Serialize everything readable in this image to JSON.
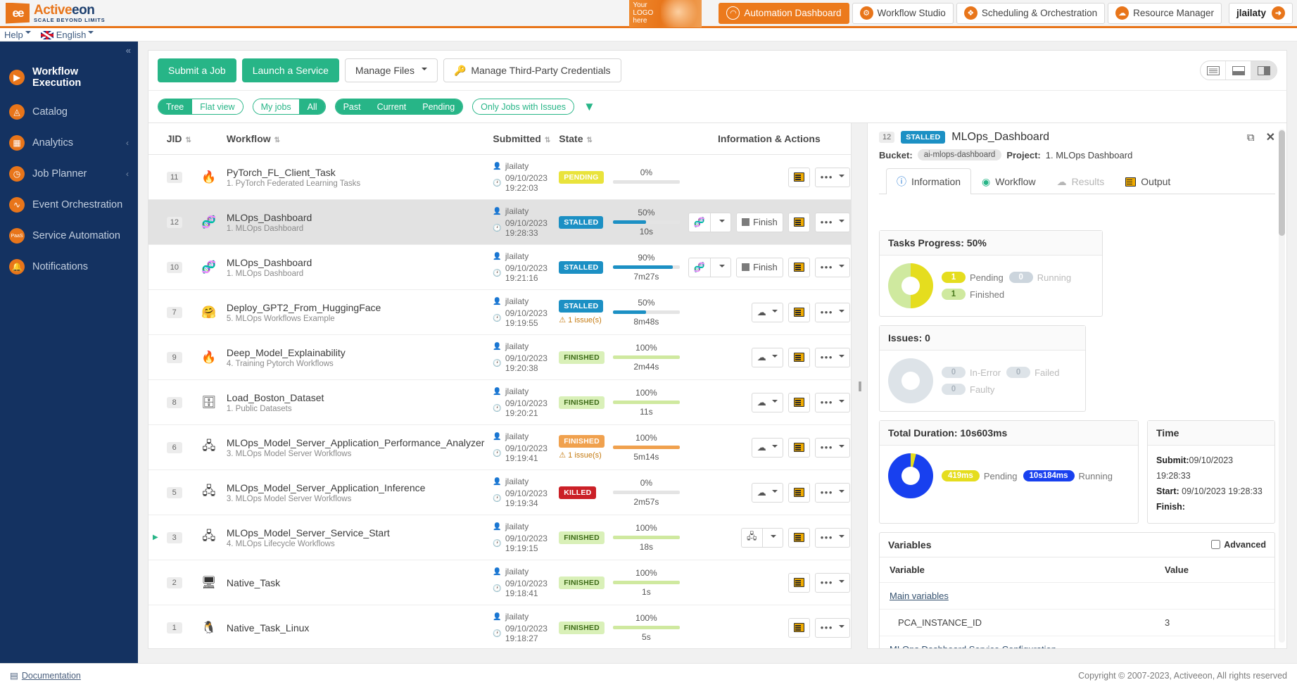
{
  "brand": {
    "name_part1": "Active",
    "name_part2": "eon",
    "tagline": "SCALE BEYOND LIMITS",
    "mark": "ee"
  },
  "help_row": {
    "help_label": "Help",
    "language_label": "English"
  },
  "promo": {
    "line1": "Your",
    "line2": "LOGO",
    "line3": "here"
  },
  "nav": {
    "items": [
      {
        "label": "Automation Dashboard",
        "icon": "gauge-icon",
        "active": true
      },
      {
        "label": "Workflow Studio",
        "icon": "workflow-studio-icon",
        "active": false
      },
      {
        "label": "Scheduling & Orchestration",
        "icon": "scheduling-icon",
        "active": false
      },
      {
        "label": "Resource Manager",
        "icon": "resource-manager-icon",
        "active": false
      }
    ],
    "user": "jlailaty"
  },
  "sidebar": {
    "collapse_icon": "«",
    "items": [
      {
        "label": "Workflow Execution",
        "icon": "play-circle-icon",
        "active": true,
        "chevron": ""
      },
      {
        "label": "Catalog",
        "icon": "catalog-icon",
        "active": false,
        "chevron": ""
      },
      {
        "label": "Analytics",
        "icon": "analytics-icon",
        "active": false,
        "chevron": "‹"
      },
      {
        "label": "Job Planner",
        "icon": "clock-icon",
        "active": false,
        "chevron": "‹"
      },
      {
        "label": "Event Orchestration",
        "icon": "pulse-icon",
        "active": false,
        "chevron": ""
      },
      {
        "label": "Service Automation",
        "icon": "paas-icon",
        "active": false,
        "chevron": ""
      },
      {
        "label": "Notifications",
        "icon": "bell-icon",
        "active": false,
        "chevron": ""
      }
    ]
  },
  "toolbar": {
    "submit_job": "Submit a Job",
    "launch_service": "Launch a Service",
    "manage_files": "Manage Files",
    "manage_credentials": "Manage Third-Party Credentials",
    "credentials_icon": "key-icon",
    "view_modes": [
      {
        "name": "list-view",
        "active": false
      },
      {
        "name": "split-horizontal-view",
        "active": false
      },
      {
        "name": "split-vertical-view",
        "active": true
      }
    ]
  },
  "filters": {
    "group1": [
      {
        "label": "Tree",
        "on": true
      },
      {
        "label": "Flat view",
        "on": false
      }
    ],
    "group2": [
      {
        "label": "My jobs",
        "on": false
      },
      {
        "label": "All",
        "on": true
      }
    ],
    "group3": [
      {
        "label": "Past",
        "on": true
      },
      {
        "label": "Current",
        "on": true
      },
      {
        "label": "Pending",
        "on": true
      }
    ],
    "group4": [
      {
        "label": "Only Jobs with Issues",
        "on": false
      }
    ],
    "funnel_icon": "filter-funnel-icon"
  },
  "table": {
    "headers": [
      "JID",
      "Workflow",
      "Submitted",
      "State",
      "Information & Actions"
    ],
    "rows": [
      {
        "jid": "11",
        "icon": "🔥",
        "name": "PyTorch_FL_Client_Task",
        "project": "1. PyTorch Federated Learning Tasks",
        "user": "jlailaty",
        "time": "09/10/2023 19:22:03",
        "state": "PENDING",
        "state_class": "st-PENDING",
        "issues": "",
        "pct": "0%",
        "pct_val": 0,
        "bar_color": "#d9d9d9",
        "duration": "",
        "expand": false,
        "selected": false,
        "actions": {
          "primary": "",
          "finish": false,
          "cloud": false,
          "output": true,
          "more": true
        }
      },
      {
        "jid": "12",
        "icon": "🧬",
        "name": "MLOps_Dashboard",
        "project": "1. MLOps Dashboard",
        "user": "jlailaty",
        "time": "09/10/2023 19:28:33",
        "state": "STALLED",
        "state_class": "st-STALLED",
        "issues": "",
        "pct": "50%",
        "pct_val": 50,
        "bar_color": "#1c90c4",
        "duration": "10s",
        "expand": false,
        "selected": true,
        "actions": {
          "primary": "service-icon",
          "finish": true,
          "finish_label": "Finish",
          "cloud": false,
          "output": true,
          "more": true
        }
      },
      {
        "jid": "10",
        "icon": "🧬",
        "name": "MLOps_Dashboard",
        "project": "1. MLOps Dashboard",
        "user": "jlailaty",
        "time": "09/10/2023 19:21:16",
        "state": "STALLED",
        "state_class": "st-STALLED",
        "issues": "",
        "pct": "90%",
        "pct_val": 90,
        "bar_color": "#1c90c4",
        "duration": "7m27s",
        "expand": false,
        "selected": false,
        "actions": {
          "primary": "service-icon",
          "finish": true,
          "finish_label": "Finish",
          "cloud": false,
          "output": true,
          "more": true
        }
      },
      {
        "jid": "7",
        "icon": "🤗",
        "name": "Deploy_GPT2_From_HuggingFace",
        "project": "5. MLOps Workflows Example",
        "user": "jlailaty",
        "time": "09/10/2023 19:19:55",
        "state": "STALLED",
        "state_class": "st-STALLED",
        "issues": "1 issue(s)",
        "pct": "50%",
        "pct_val": 50,
        "bar_color": "#1c90c4",
        "duration": "8m48s",
        "expand": false,
        "selected": false,
        "actions": {
          "primary": "",
          "finish": false,
          "cloud": true,
          "output": true,
          "more": true
        }
      },
      {
        "jid": "9",
        "icon": "🔥",
        "name": "Deep_Model_Explainability",
        "project": "4. Training Pytorch Workflows",
        "user": "jlailaty",
        "time": "09/10/2023 19:20:38",
        "state": "FINISHED",
        "state_class": "st-FINISHED",
        "issues": "",
        "pct": "100%",
        "pct_val": 100,
        "bar_color": "#cfe99f",
        "duration": "2m44s",
        "expand": false,
        "selected": false,
        "actions": {
          "primary": "",
          "finish": false,
          "cloud": true,
          "output": true,
          "more": true
        }
      },
      {
        "jid": "8",
        "icon": "🗄",
        "name": "Load_Boston_Dataset",
        "project": "1. Public Datasets",
        "user": "jlailaty",
        "time": "09/10/2023 19:20:21",
        "state": "FINISHED",
        "state_class": "st-FINISHED",
        "issues": "",
        "pct": "100%",
        "pct_val": 100,
        "bar_color": "#cfe99f",
        "duration": "11s",
        "expand": false,
        "selected": false,
        "actions": {
          "primary": "",
          "finish": false,
          "cloud": true,
          "output": true,
          "more": true
        }
      },
      {
        "jid": "6",
        "icon": "🖧",
        "name": "MLOps_Model_Server_Application_Performance_Analyzer",
        "project": "3. MLOps Model Server Workflows",
        "user": "jlailaty",
        "time": "09/10/2023 19:19:41",
        "state": "FINISHED",
        "state_class": "st-FINISHED-issue",
        "issues": "1 issue(s)",
        "pct": "100%",
        "pct_val": 100,
        "bar_color": "#f0a14e",
        "duration": "5m14s",
        "expand": false,
        "selected": false,
        "actions": {
          "primary": "",
          "finish": false,
          "cloud": true,
          "output": true,
          "more": true
        }
      },
      {
        "jid": "5",
        "icon": "🖧",
        "name": "MLOps_Model_Server_Application_Inference",
        "project": "3. MLOps Model Server Workflows",
        "user": "jlailaty",
        "time": "09/10/2023 19:19:34",
        "state": "KILLED",
        "state_class": "st-KILLED",
        "issues": "",
        "pct": "0%",
        "pct_val": 0,
        "bar_color": "#d9d9d9",
        "duration": "2m57s",
        "expand": false,
        "selected": false,
        "actions": {
          "primary": "",
          "finish": false,
          "cloud": true,
          "output": true,
          "more": true
        }
      },
      {
        "jid": "3",
        "icon": "🖧",
        "name": "MLOps_Model_Server_Service_Start",
        "project": "4. MLOps Lifecycle Workflows",
        "user": "jlailaty",
        "time": "09/10/2023 19:19:15",
        "state": "FINISHED",
        "state_class": "st-FINISHED",
        "issues": "",
        "pct": "100%",
        "pct_val": 100,
        "bar_color": "#cfe99f",
        "duration": "18s",
        "expand": true,
        "selected": false,
        "actions": {
          "primary": "model-server-icon",
          "finish": false,
          "cloud": false,
          "output": true,
          "more": true
        }
      },
      {
        "jid": "2",
        "icon": "🖥",
        "name": "Native_Task",
        "project": "",
        "user": "jlailaty",
        "time": "09/10/2023 19:18:41",
        "state": "FINISHED",
        "state_class": "st-FINISHED",
        "issues": "",
        "pct": "100%",
        "pct_val": 100,
        "bar_color": "#cfe99f",
        "duration": "1s",
        "expand": false,
        "selected": false,
        "actions": {
          "primary": "",
          "finish": false,
          "cloud": false,
          "output": true,
          "more": true
        }
      },
      {
        "jid": "1",
        "icon": "🐧",
        "name": "Native_Task_Linux",
        "project": "",
        "user": "jlailaty",
        "time": "09/10/2023 19:18:27",
        "state": "FINISHED",
        "state_class": "st-FINISHED",
        "issues": "",
        "pct": "100%",
        "pct_val": 100,
        "bar_color": "#cfe99f",
        "duration": "5s",
        "expand": false,
        "selected": false,
        "actions": {
          "primary": "",
          "finish": false,
          "cloud": false,
          "output": true,
          "more": true
        }
      }
    ]
  },
  "detail": {
    "jid": "12",
    "state": "STALLED",
    "title": "MLOps_Dashboard",
    "bucket_label": "Bucket:",
    "bucket_value": "ai-mlops-dashboard",
    "project_label": "Project:",
    "project_value": "1. MLOps Dashboard",
    "tabs": [
      {
        "label": "Information",
        "icon": "info-icon",
        "active": true,
        "disabled": false
      },
      {
        "label": "Workflow",
        "icon": "eye-icon",
        "active": false,
        "disabled": false
      },
      {
        "label": "Results",
        "icon": "cloud-down-icon",
        "active": false,
        "disabled": true
      },
      {
        "label": "Output",
        "icon": "output-icon",
        "active": false,
        "disabled": false
      }
    ],
    "tasks_progress": {
      "title": "Tasks Progress: 50%",
      "legend": [
        {
          "count": "1",
          "label": "Pending",
          "color": "#e5dd1e",
          "dim": false
        },
        {
          "count": "0",
          "label": "Running",
          "color": "#ccd5dd",
          "dim": true
        },
        {
          "count": "1",
          "label": "Finished",
          "color": "#cfe99f",
          "dim": false
        }
      ]
    },
    "issues": {
      "title": "Issues: 0",
      "legend": [
        {
          "count": "0",
          "label": "In-Error",
          "color": "#dde3e8",
          "dim": true
        },
        {
          "count": "0",
          "label": "Failed",
          "color": "#dde3e8",
          "dim": true
        },
        {
          "count": "0",
          "label": "Faulty",
          "color": "#dde3e8",
          "dim": true
        }
      ]
    },
    "duration": {
      "title": "Total Duration: 10s603ms",
      "legend": [
        {
          "count": "419ms",
          "label": "Pending",
          "color": "#e5dd1e",
          "dim": false
        },
        {
          "count": "10s184ms",
          "label": "Running",
          "color": "#1840ef",
          "dim": false
        }
      ]
    },
    "time": {
      "title": "Time",
      "submit_label": "Submit:",
      "submit_value": "09/10/2023 19:28:33",
      "start_label": "Start:",
      "start_value": "09/10/2023 19:28:33",
      "finish_label": "Finish:",
      "finish_value": ""
    },
    "variables": {
      "title": "Variables",
      "advanced_label": "Advanced",
      "col_variable": "Variable",
      "col_value": "Value",
      "rows": [
        {
          "name": "Main variables",
          "value": "",
          "group": true
        },
        {
          "name": "PCA_INSTANCE_ID",
          "value": "3",
          "group": false
        },
        {
          "name": "MLOps Dashboard Service Configuration",
          "value": "",
          "group": true
        }
      ]
    },
    "maximize_icon": "restore-icon",
    "close_icon": "close-icon"
  },
  "footer": {
    "documentation": "Documentation",
    "documentation_icon": "book-icon",
    "copyright": "Copyright © 2007-2023, Activeeon, All rights reserved"
  },
  "chart_data": [
    {
      "type": "pie",
      "title": "Tasks Progress: 50%",
      "categories": [
        "Pending",
        "Running",
        "Finished"
      ],
      "values": [
        1,
        0,
        1
      ],
      "colors": [
        "#e5dd1e",
        "#ccd5dd",
        "#cfe99f"
      ],
      "legend": "right"
    },
    {
      "type": "pie",
      "title": "Issues: 0",
      "categories": [
        "In-Error",
        "Failed",
        "Faulty"
      ],
      "values": [
        0,
        0,
        0
      ],
      "colors": [
        "#dde3e8",
        "#dde3e8",
        "#dde3e8"
      ],
      "legend": "right"
    },
    {
      "type": "pie",
      "title": "Total Duration: 10s603ms",
      "categories": [
        "Pending",
        "Running"
      ],
      "values": [
        419,
        10184
      ],
      "unit": "ms",
      "colors": [
        "#e5dd1e",
        "#1840ef"
      ],
      "legend": "right"
    }
  ]
}
